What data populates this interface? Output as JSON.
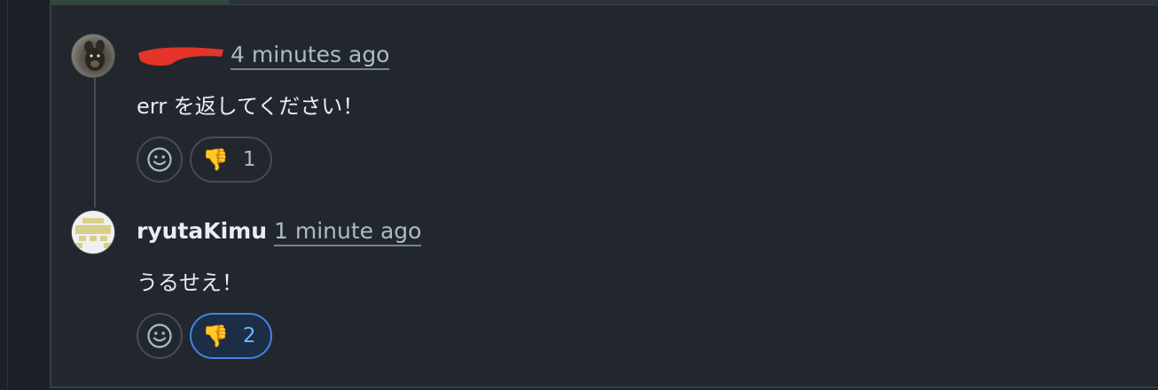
{
  "comments": [
    {
      "author": "",
      "time": "4 minutes ago",
      "body": "err を返してください！",
      "reaction": {
        "emoji": "thumbs-down",
        "glyph": "👎",
        "count": "1",
        "active": false
      }
    },
    {
      "author": "ryutaKimu",
      "time": "1 minute ago",
      "body": "うるせえ！",
      "reaction": {
        "emoji": "thumbs-down",
        "glyph": "👎",
        "count": "2",
        "active": true
      }
    }
  ],
  "icons": {
    "add_reaction": "smiley-face-icon",
    "reaction": "thumbs-down-icon"
  },
  "colors": {
    "background": "#22272e",
    "active_reaction_border": "#4184e4",
    "redaction": "#e5342a"
  }
}
